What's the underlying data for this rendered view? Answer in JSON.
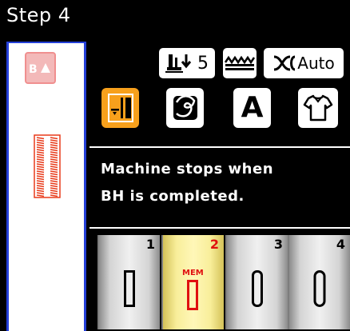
{
  "title": "Step 4",
  "settings": {
    "presser_foot_value": "5",
    "auto_label": "Auto"
  },
  "modes": {
    "icons": [
      "buttonhole-lever-icon",
      "stitch-pattern-icon",
      "letter-a-icon",
      "shirt-icon"
    ],
    "letter": "A",
    "selected_index": 0
  },
  "message": {
    "line1": "Machine stops when",
    "line2": "BH is completed."
  },
  "patterns": [
    {
      "number": "1",
      "selected": false
    },
    {
      "number": "2",
      "selected": true,
      "badge": "MEM"
    },
    {
      "number": "3",
      "selected": false
    },
    {
      "number": "4",
      "selected": false
    }
  ],
  "colors": {
    "accent_orange": "#f7a01c",
    "accent_red": "#e01010",
    "frame_blue": "#2540d8"
  }
}
